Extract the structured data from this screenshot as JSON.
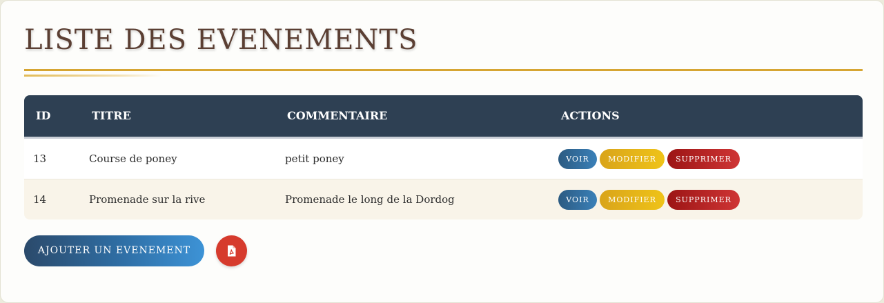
{
  "page": {
    "title": "LISTE DES EVENEMENTS"
  },
  "table": {
    "headers": [
      "ID",
      "TITRE",
      "COMMENTAIRE",
      "ACTIONS"
    ],
    "rows": [
      {
        "id": "13",
        "titre": "Course de poney",
        "commentaire": "petit poney",
        "actions": [
          "VOIR",
          "MODIFIER",
          "SUPPRIMER"
        ]
      },
      {
        "id": "14",
        "titre": "Promenade sur la rive",
        "commentaire": "Promenade le long de la Dordog",
        "actions": [
          "VOIR",
          "MODIFIER",
          "SUPPRIMER"
        ]
      }
    ]
  },
  "footer": {
    "add_label": "AJOUTER UN EVENEMENT",
    "pdf_icon": "file-pdf-icon"
  },
  "colors": {
    "title": "#5b3f33",
    "accent_gold": "#d6a532",
    "header_bg": "#2e4053",
    "voir": "#2f6fa6",
    "modifier": "#e6b41a",
    "supprimer": "#b82222",
    "pdf": "#d63b2d"
  }
}
